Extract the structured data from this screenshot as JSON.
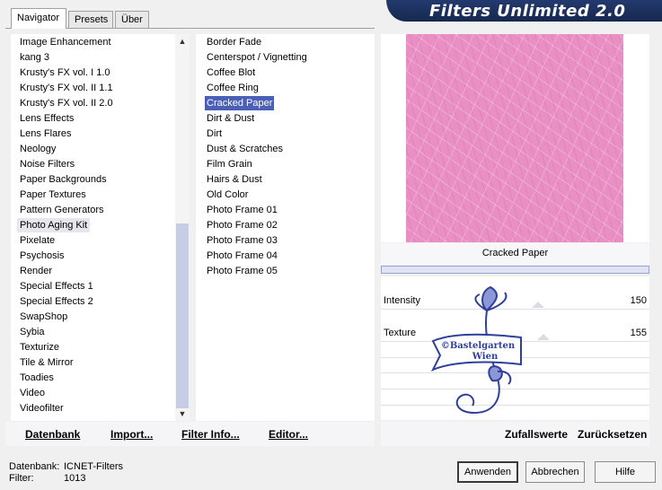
{
  "tabs": [
    {
      "label": "Navigator",
      "active": true
    },
    {
      "label": "Presets",
      "active": false
    },
    {
      "label": "Über",
      "active": false
    }
  ],
  "banner": {
    "title": "Filters Unlimited 2.0"
  },
  "categories": {
    "items": [
      "Image Enhancement",
      "kang 3",
      "Krusty's FX vol. I 1.0",
      "Krusty's FX vol. II 1.1",
      "Krusty's FX vol. II 2.0",
      "Lens Effects",
      "Lens Flares",
      "Neology",
      "Noise Filters",
      "Paper Backgrounds",
      "Paper Textures",
      "Pattern Generators",
      "Photo Aging Kit",
      "Pixelate",
      "Psychosis",
      "Render",
      "Special Effects 1",
      "Special Effects 2",
      "SwapShop",
      "Sybia",
      "Texturize",
      "Tile & Mirror",
      "Toadies",
      "Video",
      "Videofilter"
    ],
    "selected_index": 12
  },
  "filters": {
    "items": [
      "Border Fade",
      "Centerspot / Vignetting",
      "Coffee Blot",
      "Coffee Ring",
      "Cracked Paper",
      "Dirt & Dust",
      "Dirt",
      "Dust & Scratches",
      "Film Grain",
      "Hairs & Dust",
      "Old Color",
      "Photo Frame 01",
      "Photo Frame 02",
      "Photo Frame 03",
      "Photo Frame 04",
      "Photo Frame 05"
    ],
    "selected_index": 4
  },
  "left_buttons": {
    "datenbank": "Datenbank",
    "import": "Import...",
    "filter_info": "Filter Info...",
    "editor": "Editor..."
  },
  "preview": {
    "filter_name": "Cracked Paper",
    "color": "#e98fc4"
  },
  "params": [
    {
      "label": "Intensity",
      "value": "150",
      "level": 150
    },
    {
      "label": "Texture",
      "value": "155",
      "level": 155
    }
  ],
  "right_buttons": {
    "random": "Zufallswerte",
    "reset": "Zurücksetzen"
  },
  "watermark": {
    "line1": "©Bastelgarten",
    "line2": "Wien"
  },
  "status": {
    "db_label": "Datenbank:",
    "db_value": "ICNET-Filters",
    "filter_label": "Filter:",
    "filter_value": "1013"
  },
  "dialog_buttons": {
    "apply": "Anwenden",
    "cancel": "Abbrechen",
    "help": "Hilfe"
  },
  "colors": {
    "selection": "#4b5fb7",
    "banner": "#1c2f5c",
    "watermark": "#2f3f9a"
  }
}
